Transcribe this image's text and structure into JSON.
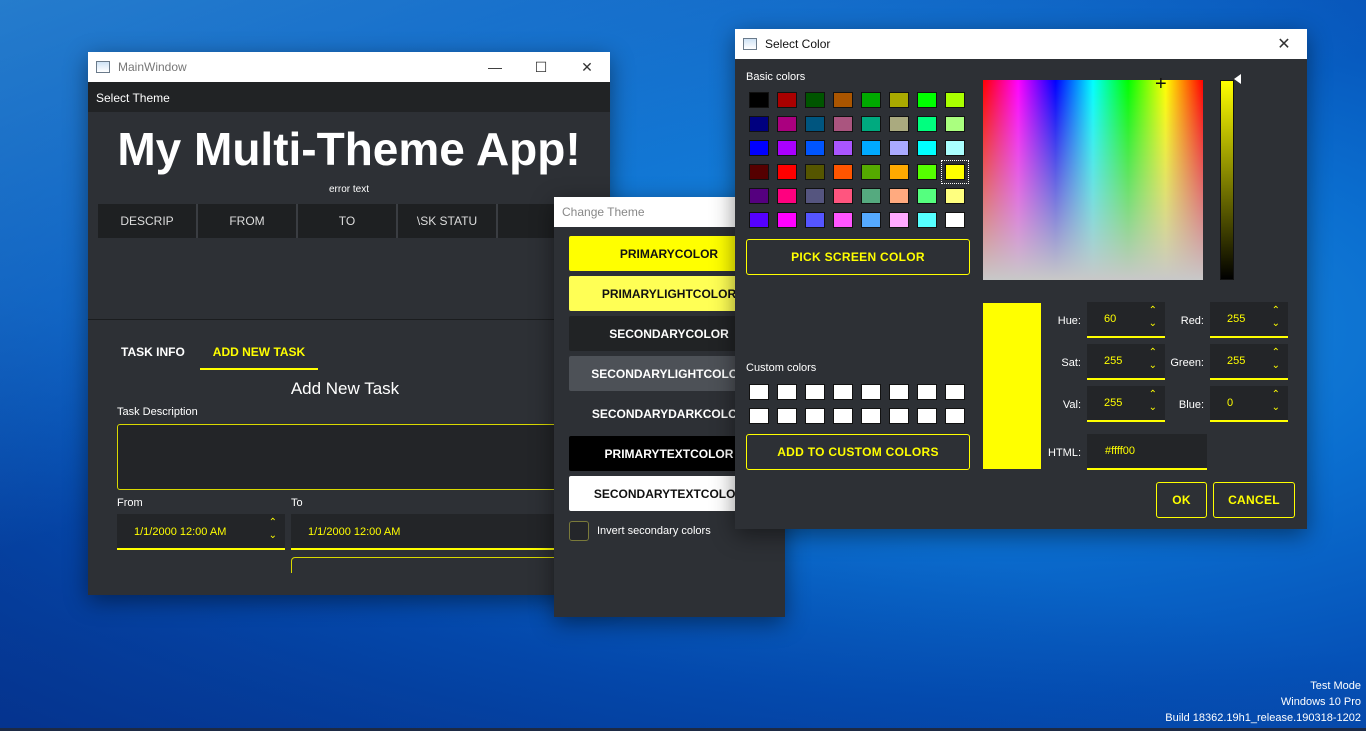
{
  "main_window": {
    "title": "MainWindow",
    "menu": "Select Theme",
    "app_title": "My Multi-Theme App!",
    "error_text": "error text",
    "columns": [
      "DESCRIP",
      "FROM",
      "TO",
      "\\SK STATU"
    ],
    "tabs": [
      "TASK INFO",
      "ADD NEW TASK"
    ],
    "section_title": "Add New Task",
    "task_description_label": "Task Description",
    "from_label": "From",
    "to_label": "To",
    "from_value": "1/1/2000 12:00 AM",
    "to_value": "1/1/2000 12:00 AM"
  },
  "theme_window": {
    "title": "Change Theme",
    "buttons": [
      {
        "label": "PRIMARYCOLOR",
        "bg": "#ffff00",
        "fg": "#111111"
      },
      {
        "label": "PRIMARYLIGHTCOLOR",
        "bg": "#ffff55",
        "fg": "#111111"
      },
      {
        "label": "SECONDARYCOLOR",
        "bg": "#212325",
        "fg": "#ffffff"
      },
      {
        "label": "SECONDARYLIGHTCOLOR",
        "bg": "#4d5157",
        "fg": "#ffffff"
      },
      {
        "label": "SECONDARYDARKCOLOR",
        "bg": "#2d3035",
        "fg": "#ffffff"
      },
      {
        "label": "PRIMARYTEXTCOLOR",
        "bg": "#000000",
        "fg": "#ffffff"
      },
      {
        "label": "SECONDARYTEXTCOLOR",
        "bg": "#ffffff",
        "fg": "#111111"
      }
    ],
    "invert_label": "Invert secondary colors"
  },
  "color_dialog": {
    "title": "Select Color",
    "basic_colors_label": "Basic colors",
    "basic_colors": [
      "#000000",
      "#aa0000",
      "#005500",
      "#aa5500",
      "#00aa00",
      "#aaaa00",
      "#00ff00",
      "#aaff00",
      "#00007f",
      "#aa007f",
      "#00557f",
      "#aa557f",
      "#00aa7f",
      "#aaaa7f",
      "#00ff7f",
      "#aaff7f",
      "#0000ff",
      "#aa00ff",
      "#0055ff",
      "#aa55ff",
      "#00aaff",
      "#aaaaff",
      "#00ffff",
      "#aaffff",
      "#550000",
      "#ff0000",
      "#555500",
      "#ff5500",
      "#55aa00",
      "#ffaa00",
      "#55ff00",
      "#ffff00",
      "#55007f",
      "#ff007f",
      "#55557f",
      "#ff557f",
      "#55aa7f",
      "#ffaa7f",
      "#55ff7f",
      "#ffff7f",
      "#5500ff",
      "#ff00ff",
      "#5555ff",
      "#ff55ff",
      "#55aaff",
      "#ffaaff",
      "#55ffff",
      "#ffffff"
    ],
    "selected_index": 31,
    "pick_screen_label": "PICK SCREEN COLOR",
    "custom_colors_label": "Custom colors",
    "add_custom_label": "ADD TO CUSTOM COLORS",
    "fields": {
      "hue": {
        "label": "Hue:",
        "value": "60"
      },
      "sat": {
        "label": "Sat:",
        "value": "255"
      },
      "val": {
        "label": "Val:",
        "value": "255"
      },
      "red": {
        "label": "Red:",
        "value": "255"
      },
      "green": {
        "label": "Green:",
        "value": "255"
      },
      "blue": {
        "label": "Blue:",
        "value": "0"
      }
    },
    "html_label": "HTML:",
    "html_value": "#ffff00",
    "current_color": "#ffff00",
    "ok_label": "OK",
    "cancel_label": "CANCEL"
  },
  "watermark": {
    "line1": "Test Mode",
    "line2": "Windows 10 Pro",
    "line3": "Build 18362.19h1_release.190318-1202"
  }
}
